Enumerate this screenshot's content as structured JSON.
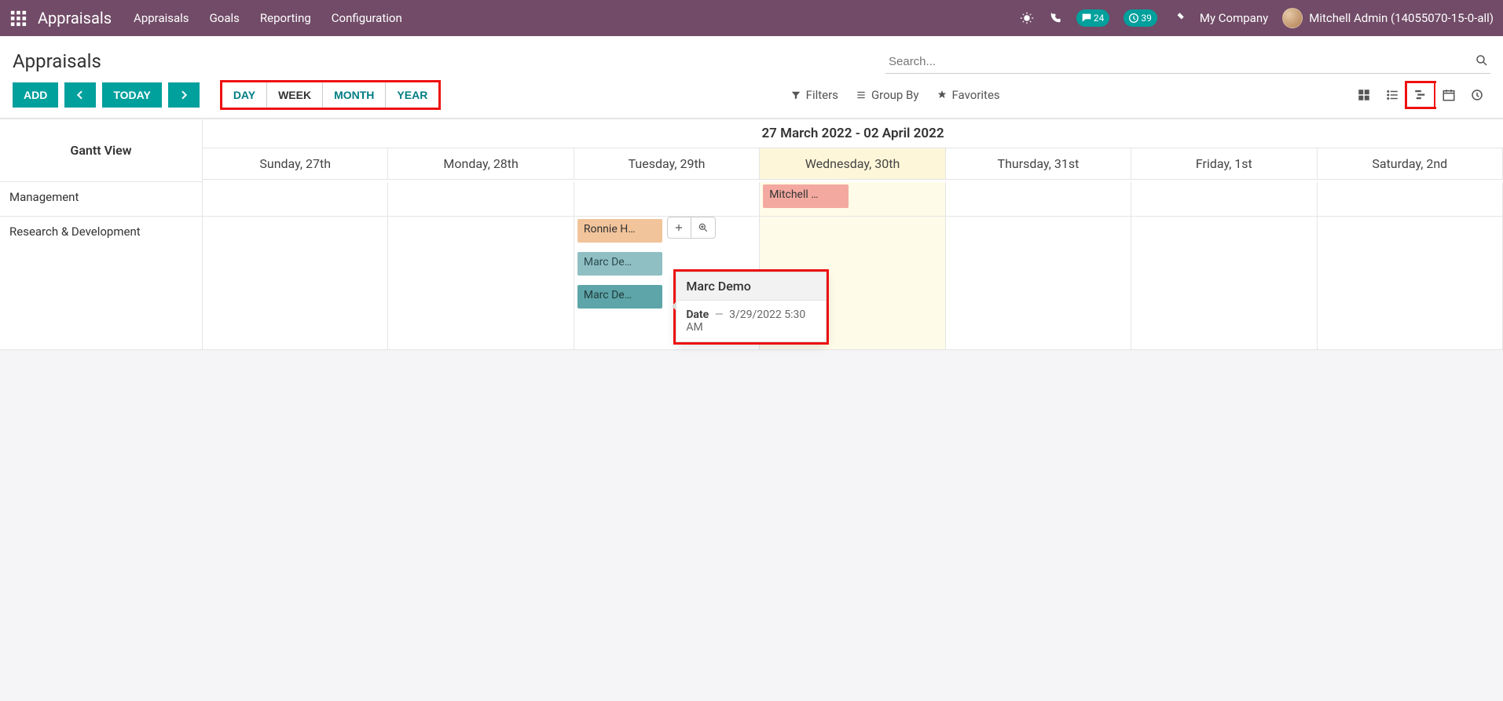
{
  "nav": {
    "brand": "Appraisals",
    "menu": [
      "Appraisals",
      "Goals",
      "Reporting",
      "Configuration"
    ],
    "messages_badge": "24",
    "activities_badge": "39",
    "company": "My Company",
    "user": "Mitchell Admin (14055070-15-0-all)"
  },
  "header": {
    "title": "Appraisals",
    "search_placeholder": "Search..."
  },
  "toolbar": {
    "add": "ADD",
    "today": "TODAY",
    "ranges": [
      "DAY",
      "WEEK",
      "MONTH",
      "YEAR"
    ],
    "active_range": "WEEK",
    "filters": "Filters",
    "groupby": "Group By",
    "favorites": "Favorites"
  },
  "gantt": {
    "title": "Gantt View",
    "range_label": "27 March 2022 - 02 April 2022",
    "days": [
      "Sunday, 27th",
      "Monday, 28th",
      "Tuesday, 29th",
      "Wednesday, 30th",
      "Thursday, 31st",
      "Friday, 1st",
      "Saturday, 2nd"
    ],
    "today_index": 3,
    "rows": [
      {
        "label": "Management"
      },
      {
        "label": "Research & Development"
      }
    ],
    "pills": {
      "mitchell": "Mitchell …",
      "ronnie": "Ronnie H…",
      "marc1": "Marc De…",
      "marc2": "Marc De…"
    }
  },
  "popover": {
    "title": "Marc Demo",
    "date_label": "Date",
    "date_value": "3/29/2022 5:30 AM"
  }
}
